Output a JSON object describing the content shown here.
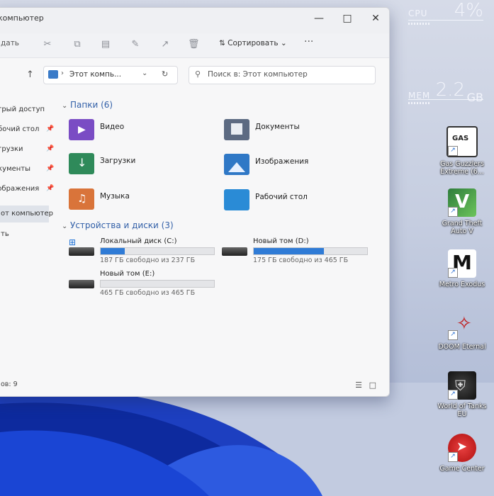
{
  "window": {
    "title": "компьютер",
    "cmd_new": "дать",
    "cmd_sort": "Сортировать",
    "more": "···",
    "address": "Этот компь...",
    "search_placeholder": "Поиск в: Этот компьютер",
    "status": "ов: 9"
  },
  "sidebar": {
    "items": [
      {
        "label": "стрый доступ"
      },
      {
        "label": "абочий стол"
      },
      {
        "label": "агрузки"
      },
      {
        "label": "окументы"
      },
      {
        "label": "зображения"
      },
      {
        "label": "от компьютер"
      },
      {
        "label": "ть"
      }
    ]
  },
  "folders": {
    "header": "Папки (6)",
    "items": [
      {
        "label": "Видео",
        "color": "#7a4cc4"
      },
      {
        "label": "Документы",
        "color": "#5c6a82"
      },
      {
        "label": "Загрузки",
        "color": "#2f8a5a"
      },
      {
        "label": "Изображения",
        "color": "#2f78c6"
      },
      {
        "label": "Музыка",
        "color": "#d9743a"
      },
      {
        "label": "Рабочий стол",
        "color": "#2a8bd6"
      }
    ]
  },
  "drives": {
    "header": "Устройства и диски (3)",
    "items": [
      {
        "name": "Локальный диск (C:)",
        "free": "187 ГБ свободно из 237 ГБ",
        "used_fraction": 0.21
      },
      {
        "name": "Новый том (D:)",
        "free": "175 ГБ свободно из 465 ГБ",
        "used_fraction": 0.62
      },
      {
        "name": "Новый том (E:)",
        "free": "465 ГБ свободно из 465 ГБ",
        "used_fraction": 0.0
      }
    ]
  },
  "meters": {
    "cpu_label": "CPU",
    "cpu_value": "4%",
    "mem_label": "MEM",
    "mem_value": "2.2",
    "mem_unit": "GB"
  },
  "desktop_icons": [
    {
      "name": "Gas Guzzlers Extreme (6...",
      "icon": "gas-guzzlers-icon"
    },
    {
      "name": "Grand Theft Auto V",
      "icon": "gta-v-icon"
    },
    {
      "name": "Metro Exodus",
      "icon": "metro-exodus-icon"
    },
    {
      "name": "DOOM Eternal",
      "icon": "doom-eternal-icon"
    },
    {
      "name": "World of Tanks EU",
      "icon": "world-of-tanks-icon"
    },
    {
      "name": "Game Center",
      "icon": "game-center-icon"
    }
  ]
}
